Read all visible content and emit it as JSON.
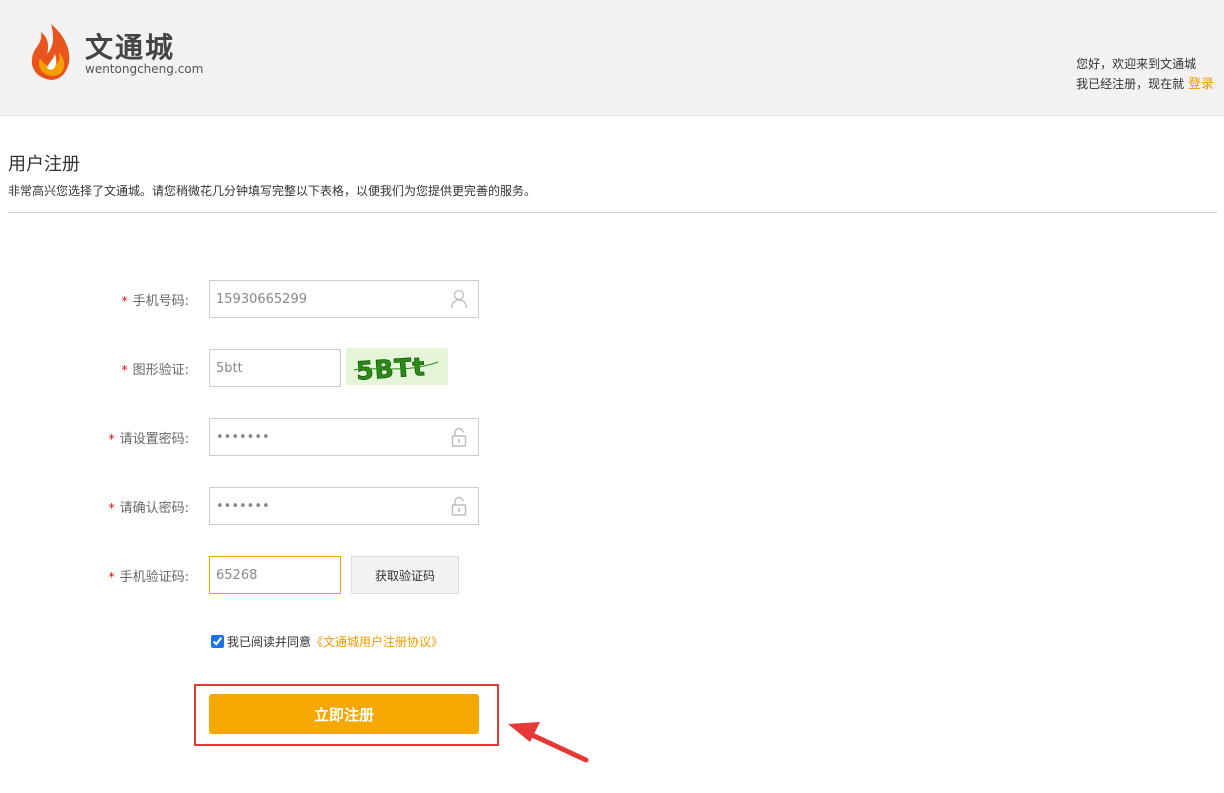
{
  "header": {
    "logo_title": "文通城",
    "logo_sub": "wentongcheng.com",
    "welcome": "您好，欢迎来到文通城",
    "registered_prompt": "我已经注册，现在就",
    "login_link": "登录"
  },
  "page": {
    "title": "用户注册",
    "description": "非常高兴您选择了文通城。请您稍微花几分钟填写完整以下表格，以便我们为您提供更完善的服务。"
  },
  "form": {
    "required_mark": "*",
    "phone": {
      "label": "手机号码:",
      "value": "15930665299"
    },
    "captcha": {
      "label": "图形验证:",
      "value": "5btt",
      "image_text": "5BTt"
    },
    "password": {
      "label": "请设置密码:",
      "value": "•••••••"
    },
    "confirm_password": {
      "label": "请确认密码:",
      "value": "•••••••"
    },
    "sms_code": {
      "label": "手机验证码:",
      "value": "65268",
      "button": "获取验证码"
    },
    "agree": {
      "text": "我已阅读并同意",
      "link": "《文通城用户注册协议》",
      "checked": true
    },
    "submit": "立即注册"
  },
  "icons": {
    "logo": "flame-logo-icon",
    "user": "user-icon",
    "lock": "lock-icon"
  },
  "colors": {
    "accent": "#f5a800",
    "link": "#f39800",
    "required": "#e00000",
    "highlight": "#e53935"
  }
}
